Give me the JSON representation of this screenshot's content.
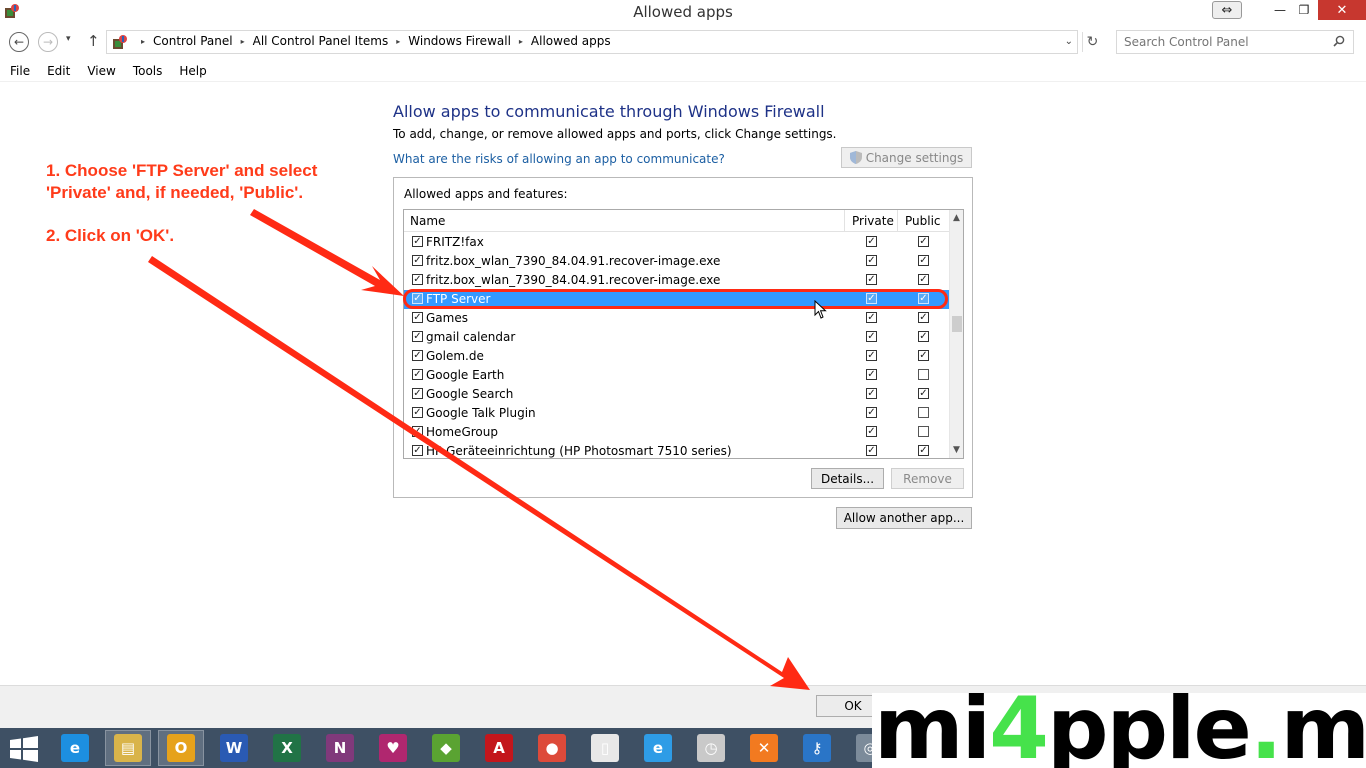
{
  "window": {
    "title": "Allowed apps",
    "snap_glyph": "⇔",
    "minimize_glyph": "—",
    "maximize_glyph": "❐",
    "close_glyph": "✕"
  },
  "address_bar": {
    "back_glyph": "←",
    "forward_glyph": "→",
    "history_glyph": "▾",
    "up_glyph": "↑",
    "crumb_sep": "▸",
    "crumbs": [
      "Control Panel",
      "All Control Panel Items",
      "Windows Firewall",
      "Allowed apps"
    ],
    "dropdown_glyph": "⌄",
    "refresh_glyph": "↻",
    "search_placeholder": "Search Control Panel"
  },
  "menu": [
    "File",
    "Edit",
    "View",
    "Tools",
    "Help"
  ],
  "content": {
    "heading": "Allow apps to communicate through Windows Firewall",
    "subtitle": "To add, change, or remove allowed apps and ports, click Change settings.",
    "risk_link": "What are the risks of allowing an app to communicate?",
    "change_settings": "Change settings",
    "group_label": "Allowed apps and features:",
    "columns": {
      "name": "Name",
      "private": "Private",
      "public": "Public"
    },
    "check_glyph": "✓",
    "rows": [
      {
        "name": "FRITZ!fax",
        "enabled": true,
        "private": true,
        "public": true
      },
      {
        "name": "fritz.box_wlan_7390_84.04.91.recover-image.exe",
        "enabled": true,
        "private": true,
        "public": true
      },
      {
        "name": "fritz.box_wlan_7390_84.04.91.recover-image.exe",
        "enabled": true,
        "private": true,
        "public": true
      },
      {
        "name": "FTP Server",
        "enabled": true,
        "private": true,
        "public": true,
        "selected": true
      },
      {
        "name": "Games",
        "enabled": true,
        "private": true,
        "public": true
      },
      {
        "name": "gmail calendar",
        "enabled": true,
        "private": true,
        "public": true
      },
      {
        "name": "Golem.de",
        "enabled": true,
        "private": true,
        "public": true
      },
      {
        "name": "Google Earth",
        "enabled": true,
        "private": true,
        "public": false
      },
      {
        "name": "Google Search",
        "enabled": true,
        "private": true,
        "public": true
      },
      {
        "name": "Google Talk Plugin",
        "enabled": true,
        "private": true,
        "public": false
      },
      {
        "name": "HomeGroup",
        "enabled": true,
        "private": true,
        "public": false
      },
      {
        "name": "HP Geräteeinrichtung (HP Photosmart 7510 series)",
        "enabled": true,
        "private": true,
        "public": true
      }
    ],
    "scroll_up_glyph": "▲",
    "scroll_down_glyph": "▼",
    "details": "Details...",
    "remove": "Remove",
    "allow_another": "Allow another app..."
  },
  "footer": {
    "ok": "OK"
  },
  "annotation": {
    "step1_line1": "1. Choose 'FTP Server' and select",
    "step1_line2": "'Private' and, if needed, 'Public'.",
    "step2": "2. Click on 'OK'.",
    "color": "#ff3b1a"
  },
  "watermark": {
    "part1": "mi",
    "accent": "4",
    "part2": "pple",
    "dot": ".",
    "part3": "me"
  },
  "taskbar": {
    "icons": [
      {
        "name": "internet-explorer-icon",
        "glyph": "e",
        "color": "#1d8fe0"
      },
      {
        "name": "file-explorer-icon",
        "glyph": "▤",
        "color": "#d9b44a",
        "active": true
      },
      {
        "name": "outlook-icon",
        "glyph": "O",
        "color": "#e6a21b",
        "active": true
      },
      {
        "name": "word-icon",
        "glyph": "W",
        "color": "#2a5ab3"
      },
      {
        "name": "excel-icon",
        "glyph": "X",
        "color": "#217346"
      },
      {
        "name": "onenote-icon",
        "glyph": "N",
        "color": "#80397b"
      },
      {
        "name": "app-heart-icon",
        "glyph": "♥",
        "color": "#b0276f"
      },
      {
        "name": "evernote-icon",
        "glyph": "◆",
        "color": "#5aa332"
      },
      {
        "name": "acrobat-icon",
        "glyph": "A",
        "color": "#c3161c"
      },
      {
        "name": "chrome-icon",
        "glyph": "●",
        "color": "#dd4a3a"
      },
      {
        "name": "blank-document-icon",
        "glyph": "▯",
        "color": "#e8e8e8"
      },
      {
        "name": "internet-explorer-alt-icon",
        "glyph": "e",
        "color": "#2e9ce6"
      },
      {
        "name": "clock-icon",
        "glyph": "◷",
        "color": "#c9c9c9"
      },
      {
        "name": "xampp-icon",
        "glyph": "✕",
        "color": "#f27a20"
      },
      {
        "name": "keychain-icon",
        "glyph": "⚷",
        "color": "#2a75c7"
      },
      {
        "name": "settings-round-icon",
        "glyph": "◎",
        "color": "#7c8b9a"
      }
    ]
  }
}
